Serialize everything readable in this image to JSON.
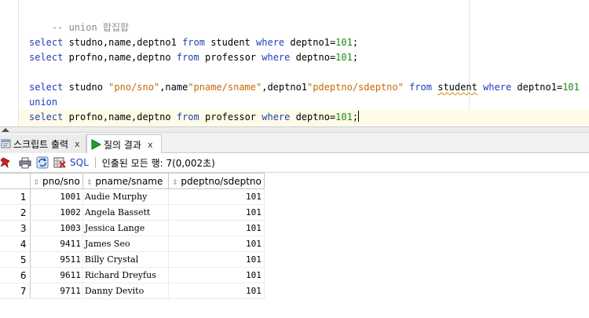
{
  "editor": {
    "comment": "-- union 합집합",
    "lines": {
      "l1": {
        "k1": "select",
        "t1": " studno,name,deptno1 ",
        "k2": "from",
        "t2": " student ",
        "k3": "where",
        "t3": " deptno1=",
        "n": "101",
        "t4": ";"
      },
      "l2": {
        "k1": "select",
        "t1": " profno,name,deptno ",
        "k2": "from",
        "t2": " professor ",
        "k3": "where",
        "t3": " deptno=",
        "n": "101",
        "t4": ";"
      },
      "l3": {
        "k1": "select",
        "t1": " studno ",
        "s1": "\"pno/sno\"",
        "t2": ",name",
        "s2": "\"pname/sname\"",
        "t3": ",deptno1",
        "s3": "\"pdeptno/sdeptno\"",
        "t4": " ",
        "k2": "from",
        "t5": " ",
        "u": "student",
        "t6": " ",
        "k3": "where",
        "t7": " deptno1=",
        "n": "101"
      },
      "l4": {
        "k1": "union"
      },
      "l5": {
        "k1": "select",
        "t1": " profno,name,deptno ",
        "k2": "from",
        "t2": " professor ",
        "k3": "where",
        "t3": " deptno=",
        "n": "101",
        "t4": ";"
      }
    }
  },
  "tabs": {
    "script_output": {
      "label": "스크립트 출력",
      "close": "x",
      "icon": "script-output-icon"
    },
    "query_result": {
      "label": "질의 결과",
      "close": "x",
      "icon": "play-icon"
    }
  },
  "toolbar": {
    "icons": [
      "pin-icon",
      "print-icon",
      "refresh-icon",
      "export-icon"
    ],
    "sql_label": "SQL",
    "status": "인출된 모든 행: 7(0,002초)"
  },
  "grid": {
    "columns": [
      "pno/sno",
      "pname/sname",
      "pdeptno/sdeptno"
    ],
    "rows": [
      {
        "num": "1",
        "pno": "1001",
        "pname": "Audie Murphy",
        "pdeptno": "101"
      },
      {
        "num": "2",
        "pno": "1002",
        "pname": "Angela Bassett",
        "pdeptno": "101"
      },
      {
        "num": "3",
        "pno": "1003",
        "pname": "Jessica Lange",
        "pdeptno": "101"
      },
      {
        "num": "4",
        "pno": "9411",
        "pname": "James Seo",
        "pdeptno": "101"
      },
      {
        "num": "5",
        "pno": "9511",
        "pname": "Billy Crystal",
        "pdeptno": "101"
      },
      {
        "num": "6",
        "pno": "9611",
        "pname": "Richard Dreyfus",
        "pdeptno": "101"
      },
      {
        "num": "7",
        "pno": "9711",
        "pname": "Danny Devito",
        "pdeptno": "101"
      }
    ]
  },
  "colors": {
    "keyword": "#1f3fb8",
    "number": "#1b8a1b",
    "string": "#c46b00",
    "comment": "#8a8a8a",
    "current_line": "#fffbe6"
  }
}
